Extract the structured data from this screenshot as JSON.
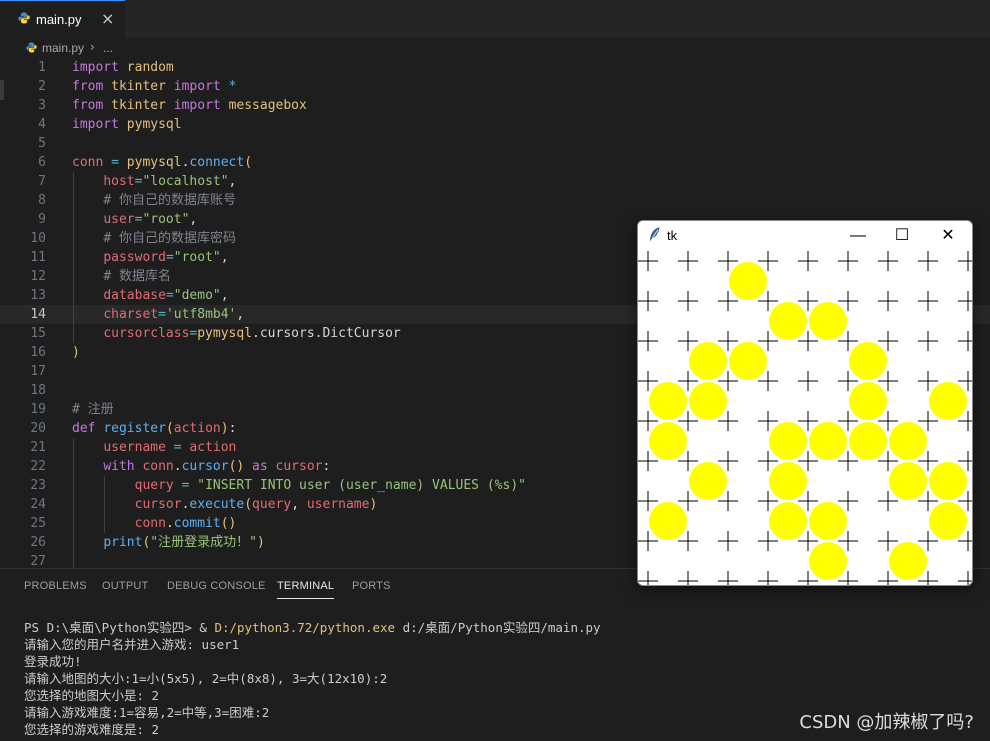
{
  "tab": {
    "filename": "main.py",
    "close": "×"
  },
  "breadcrumb": {
    "file": "main.py",
    "sep": "›",
    "more": "..."
  },
  "editor": {
    "current_line": 14,
    "lines": [
      {
        "n": "1",
        "html": "<span class=\"p\">import</span> <span class=\"y\">random</span>"
      },
      {
        "n": "2",
        "html": "<span class=\"p\">from</span> <span class=\"y\">tkinter</span> <span class=\"p\">import</span> <span class=\"t\">*</span>"
      },
      {
        "n": "3",
        "html": "<span class=\"p\">from</span> <span class=\"y\">tkinter</span> <span class=\"p\">import</span> <span class=\"y\">messagebox</span>"
      },
      {
        "n": "4",
        "html": "<span class=\"p\">import</span> <span class=\"y\">pymysql</span>"
      },
      {
        "n": "5",
        "html": ""
      },
      {
        "n": "6",
        "html": "<span class=\"r\">conn</span> <span class=\"t\">=</span> <span class=\"y\">pymysql</span>.<span class=\"b\">connect</span><span class=\"y\">(</span>"
      },
      {
        "n": "7",
        "html": "    <span class=\"r\">host</span><span class=\"t\">=</span><span class=\"g\">\"localhost\"</span>,"
      },
      {
        "n": "8",
        "html": "    <span class=\"cm\"># 你自己的数据库账号</span>"
      },
      {
        "n": "9",
        "html": "    <span class=\"r\">user</span><span class=\"t\">=</span><span class=\"g\">\"root\"</span>,"
      },
      {
        "n": "10",
        "html": "    <span class=\"cm\"># 你自己的数据库密码</span>"
      },
      {
        "n": "11",
        "html": "    <span class=\"r\">password</span><span class=\"t\">=</span><span class=\"g\">\"root\"</span>,"
      },
      {
        "n": "12",
        "html": "    <span class=\"cm\"># 数据库名</span>"
      },
      {
        "n": "13",
        "html": "    <span class=\"r\">database</span><span class=\"t\">=</span><span class=\"g\">\"demo\"</span>,"
      },
      {
        "n": "14",
        "html": "    <span class=\"r\">charset</span><span class=\"t\">=</span><span class=\"g\">'utf8mb4'</span>,"
      },
      {
        "n": "15",
        "html": "    <span class=\"r\">cursorclass</span><span class=\"t\">=</span><span class=\"y\">pymysql</span>.<span class=\"o\">cursors</span>.<span class=\"o\">DictCursor</span>"
      },
      {
        "n": "16",
        "html": "<span class=\"y\">)</span>"
      },
      {
        "n": "17",
        "html": ""
      },
      {
        "n": "18",
        "html": ""
      },
      {
        "n": "19",
        "html": "<span class=\"cm\"># 注册</span>"
      },
      {
        "n": "20",
        "html": "<span class=\"p\">def</span> <span class=\"b\">register</span><span class=\"y\">(</span><span class=\"r\">action</span><span class=\"y\">)</span>:"
      },
      {
        "n": "21",
        "html": "    <span class=\"r\">username</span> <span class=\"t\">=</span> <span class=\"r\">action</span>"
      },
      {
        "n": "22",
        "html": "    <span class=\"p\">with</span> <span class=\"r\">conn</span>.<span class=\"b\">cursor</span><span class=\"y\">()</span> <span class=\"p\">as</span> <span class=\"r\">cursor</span>:"
      },
      {
        "n": "23",
        "html": "        <span class=\"r\">query</span> <span class=\"t\">=</span> <span class=\"g\">\"INSERT INTO user (user_name) VALUES (%s)\"</span>"
      },
      {
        "n": "24",
        "html": "        <span class=\"r\">cursor</span>.<span class=\"b\">execute</span><span class=\"y\">(</span><span class=\"r\">query</span>, <span class=\"r\">username</span><span class=\"y\">)</span>"
      },
      {
        "n": "25",
        "html": "        <span class=\"r\">conn</span>.<span class=\"b\">commit</span><span class=\"y\">()</span>"
      },
      {
        "n": "26",
        "html": "    <span class=\"b\">print</span><span class=\"y\">(</span><span class=\"g\">\"注册登录成功！\"</span><span class=\"y\">)</span>"
      },
      {
        "n": "27",
        "html": ""
      }
    ]
  },
  "panel": {
    "tabs": [
      {
        "label": "PROBLEMS",
        "active": false
      },
      {
        "label": "OUTPUT",
        "active": false
      },
      {
        "label": "DEBUG CONSOLE",
        "active": false
      },
      {
        "label": "TERMINAL",
        "active": true
      },
      {
        "label": "PORTS",
        "active": false
      }
    ],
    "terminal": {
      "prompt": "PS D:\\桌面\\Python实验四> & ",
      "exe": "D:/python3.72/python.exe",
      "arg": " d:/桌面/Python实验四/main.py",
      "lines": [
        "请输入您的用户名并进入游戏: user1",
        "登录成功!",
        "请输入地图的大小:1=小(5x5), 2=中(8x8), 3=大(12x10):2",
        "您选择的地图大小是: 2",
        "请输入游戏难度:1=容易,2=中等,3=困难:2",
        "您选择的游戏难度是: 2"
      ]
    }
  },
  "watermark": "CSDN @加辣椒了吗?",
  "tk_window": {
    "title": "tk",
    "minimize": "—",
    "maximize": "☐",
    "close": "✕",
    "grid_size": 8,
    "circle_color": "#ffff00",
    "circles": [
      [
        2,
        0
      ],
      [
        3,
        1
      ],
      [
        4,
        1
      ],
      [
        1,
        2
      ],
      [
        2,
        2
      ],
      [
        5,
        2
      ],
      [
        0,
        3
      ],
      [
        1,
        3
      ],
      [
        5,
        3
      ],
      [
        7,
        3
      ],
      [
        0,
        4
      ],
      [
        3,
        4
      ],
      [
        4,
        4
      ],
      [
        5,
        4
      ],
      [
        6,
        4
      ],
      [
        1,
        5
      ],
      [
        3,
        5
      ],
      [
        6,
        5
      ],
      [
        7,
        5
      ],
      [
        0,
        6
      ],
      [
        3,
        6
      ],
      [
        4,
        6
      ],
      [
        7,
        6
      ],
      [
        4,
        7
      ],
      [
        6,
        7
      ]
    ]
  }
}
